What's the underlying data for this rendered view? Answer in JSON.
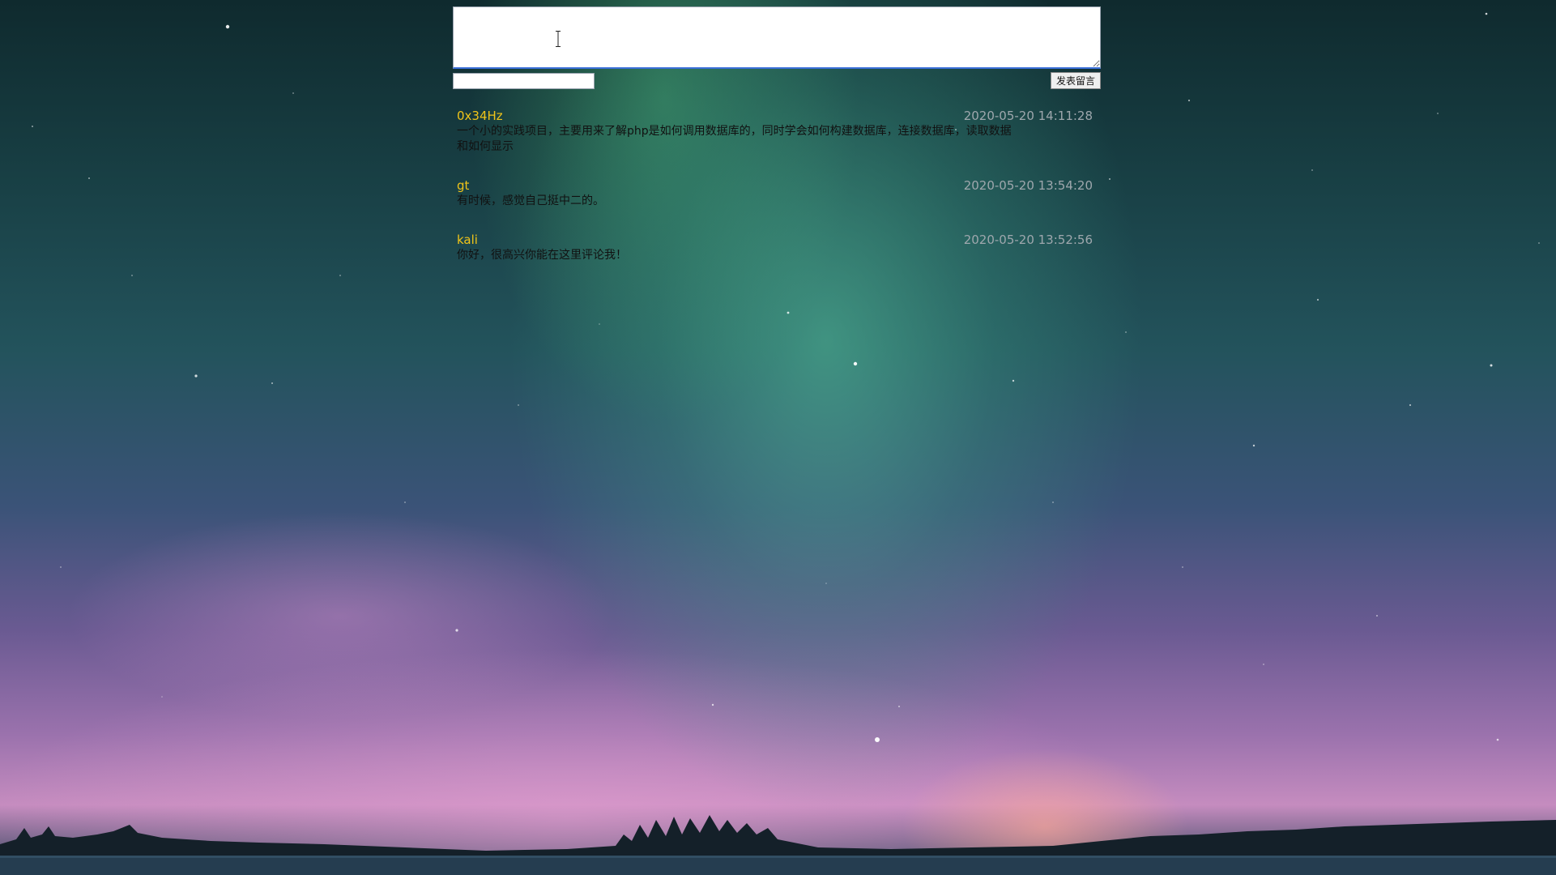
{
  "composer": {
    "message_value": "",
    "name_value": "",
    "submit_label": "发表留言"
  },
  "comments": [
    {
      "author": "0x34Hz",
      "time": "2020-05-20 14:11:28",
      "content": "一个小的实践项目，主要用来了解php是如何调用数据库的，同时学会如何构建数据库，连接数据库，读取数据\n和如何显示"
    },
    {
      "author": "gt",
      "time": "2020-05-20 13:54:20",
      "content": "有时候，感觉自己挺中二的。"
    },
    {
      "author": "kali",
      "time": "2020-05-20 13:52:56",
      "content": "你好，很高兴你能在这里评论我！"
    }
  ],
  "colors": {
    "author": "#f0c419",
    "timestamp": "#9ea7ad",
    "content": "#111111",
    "input_focus_border": "#3a6fd8"
  },
  "background": "aurora night sky photo"
}
